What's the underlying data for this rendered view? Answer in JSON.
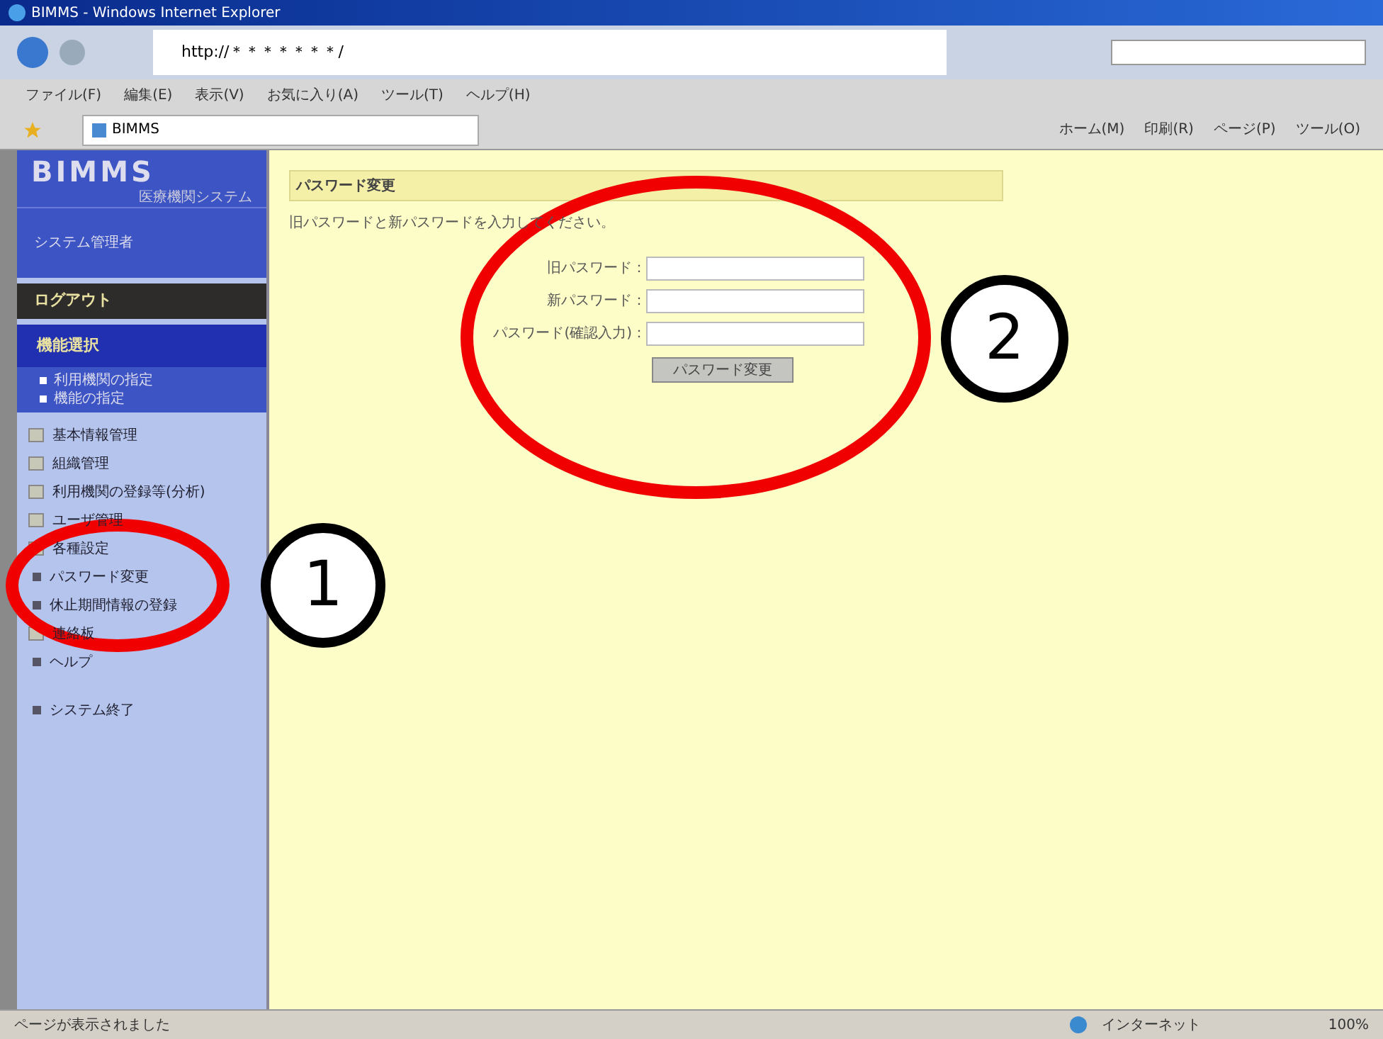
{
  "browser": {
    "title": "BIMMS - Windows Internet Explorer",
    "url": "http://＊＊＊＊＊＊＊/",
    "menu": [
      "ファイル(F)",
      "編集(E)",
      "表示(V)",
      "お気に入り(A)",
      "ツール(T)",
      "ヘルプ(H)"
    ],
    "tab": "BIMMS",
    "toolbar": [
      "ホーム(M)",
      "印刷(R)",
      "ページ(P)",
      "ツール(O)"
    ]
  },
  "sidebar": {
    "logo": "BIMMS",
    "logo_sub": "医療機関システム",
    "user": "システム管理者",
    "logout": "ログアウト",
    "section": "機能選択",
    "sub_links": [
      "利用機関の指定",
      "機能の指定"
    ],
    "items": [
      {
        "kind": "box",
        "label": "基本情報管理"
      },
      {
        "kind": "box",
        "label": "組織管理"
      },
      {
        "kind": "box",
        "label": "利用機関の登録等(分析)"
      },
      {
        "kind": "box",
        "label": "ユーザ管理"
      },
      {
        "kind": "box",
        "label": "各種設定"
      },
      {
        "kind": "dot",
        "label": "パスワード変更"
      },
      {
        "kind": "dot",
        "label": "休止期間情報の登録"
      },
      {
        "kind": "box",
        "label": "連絡板"
      },
      {
        "kind": "dot",
        "label": "ヘルプ"
      },
      {
        "kind": "gap",
        "label": "システム終了"
      }
    ]
  },
  "main": {
    "heading": "パスワード変更",
    "instructions": "旧パスワードと新パスワードを入力してください。",
    "fields": [
      {
        "label": "旧パスワード："
      },
      {
        "label": "新パスワード："
      },
      {
        "label": "パスワード(確認入力)："
      }
    ],
    "button": "パスワード変更"
  },
  "status_bar": {
    "text": "ページが表示されました",
    "zone": "インターネット",
    "zoom": "100%"
  },
  "annotations": [
    {
      "kind": "oval"
    },
    {
      "kind": "number",
      "label": "1"
    },
    {
      "kind": "oval"
    },
    {
      "kind": "number",
      "label": "2"
    }
  ]
}
